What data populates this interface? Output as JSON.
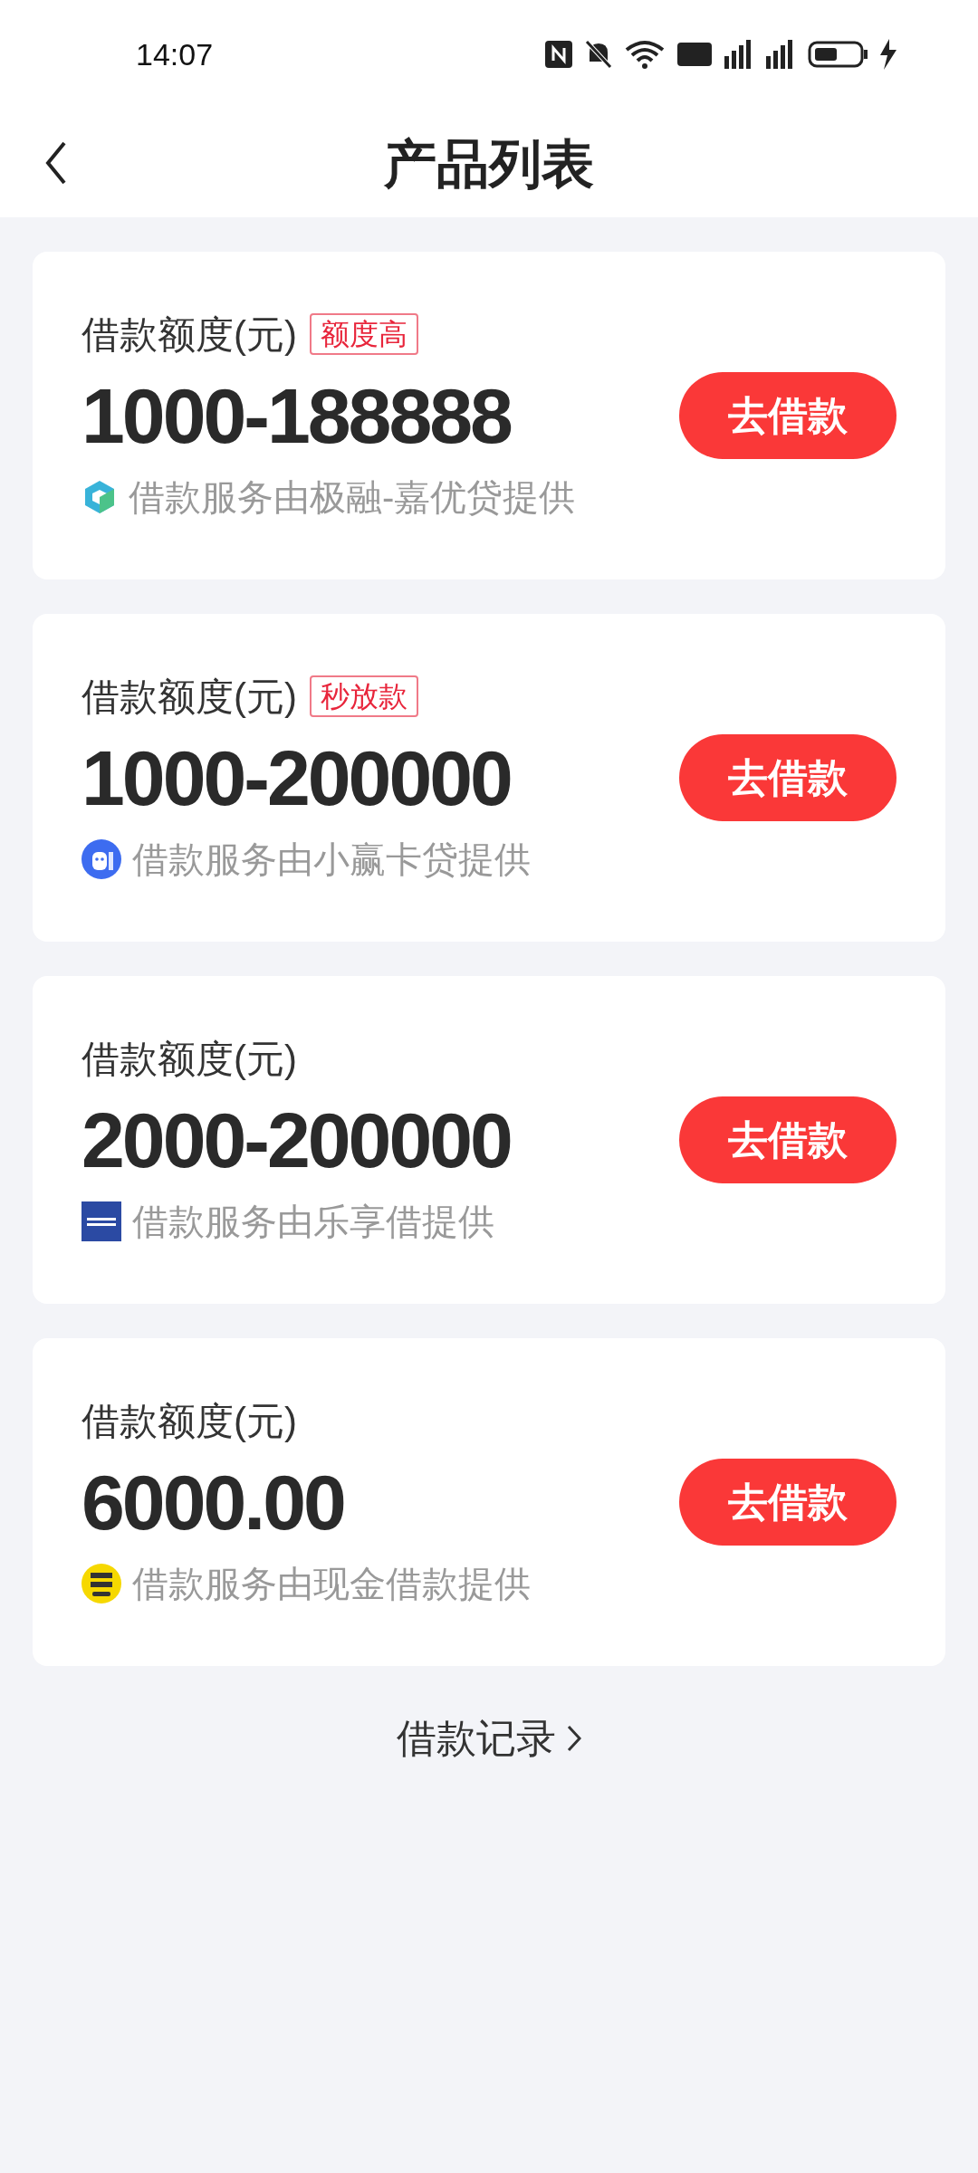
{
  "status_bar": {
    "time": "14:07"
  },
  "header": {
    "title": "产品列表"
  },
  "products": [
    {
      "label": "借款额度(元)",
      "tag": "额度高",
      "amount": "1000-188888",
      "provider": "借款服务由极融-嘉优贷提供",
      "kind": "cube",
      "button": "去借款"
    },
    {
      "label": "借款额度(元)",
      "tag": "秒放款",
      "amount": "1000-200000",
      "provider": "借款服务由小赢卡贷提供",
      "kind": "robot",
      "button": "去借款"
    },
    {
      "label": "借款额度(元)",
      "amount": "2000-200000",
      "provider": "借款服务由乐享借提供",
      "kind": "square",
      "button": "去借款"
    },
    {
      "label": "借款额度(元)",
      "amount": "6000.00",
      "provider": "借款服务由现金借款提供",
      "kind": "coin",
      "button": "去借款"
    }
  ],
  "footer_link": "借款记录"
}
